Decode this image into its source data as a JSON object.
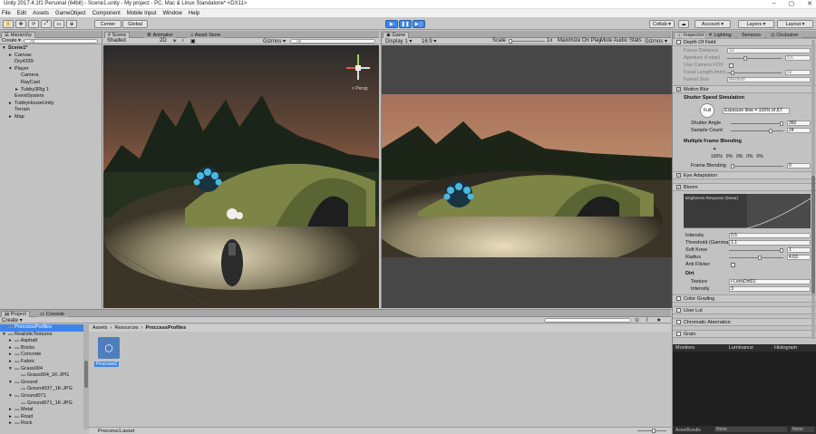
{
  "window": {
    "title": "Unity 2017.4.1f1 Personal (64bit) - Scene1.unity - My project - PC, Mac & Linux Standalone* <DX11>",
    "controls": [
      "–",
      "▢",
      "✕"
    ]
  },
  "menu": [
    "File",
    "Edit",
    "Assets",
    "GameObject",
    "Component",
    "Mobile Input",
    "Window",
    "Help"
  ],
  "toolbar": {
    "center": "Center",
    "global": "Global",
    "collab": "Collab ▾",
    "account": "Account",
    "layers": "Layers",
    "layout": "Layout"
  },
  "hierarchy": {
    "tab": "Hierarchy",
    "create": "Create ▾",
    "search": "All",
    "items": [
      {
        "label": "Scene1*",
        "depth": 0,
        "arrow": "▾",
        "sel": false
      },
      {
        "label": "Canvas",
        "depth": 1,
        "arrow": "▸"
      },
      {
        "label": "Dry4339",
        "depth": 1,
        "arrow": ""
      },
      {
        "label": "Player",
        "depth": 1,
        "arrow": "▾"
      },
      {
        "label": "Camera",
        "depth": 2,
        "arrow": ""
      },
      {
        "label": "RayCast",
        "depth": 2,
        "arrow": ""
      },
      {
        "label": "Tubby3Rig 1",
        "depth": 2,
        "arrow": "▸"
      },
      {
        "label": "EventSystem",
        "depth": 1,
        "arrow": ""
      },
      {
        "label": "TubbyHouseUnity",
        "depth": 1,
        "arrow": "▸"
      },
      {
        "label": "Terrain",
        "depth": 1,
        "arrow": ""
      },
      {
        "label": "Map",
        "depth": 1,
        "arrow": "▸"
      }
    ]
  },
  "scene": {
    "tabs": [
      "Scene",
      "Animator",
      "Asset Store"
    ],
    "shaded": "Shaded",
    "mode2d": "2D",
    "gizmos": "Gizmos ▾",
    "search": "All",
    "persp": "< Persp"
  },
  "game": {
    "tab": "Game",
    "display": "Display 1",
    "aspect": "16:9",
    "scale_label": "Scale",
    "scale_value": "1x",
    "buttons": [
      "Maximize On Play",
      "Mute Audio",
      "Stats",
      "Gizmos ▾"
    ]
  },
  "inspector": {
    "tabs": [
      "Inspector",
      "Lighting",
      "Services",
      "Occlusion"
    ],
    "dof": {
      "title": "Depth Of Field",
      "rows": [
        {
          "label": "Focus Distance",
          "value": "10"
        },
        {
          "label": "Aperture (f-stop)",
          "value": "5.6"
        },
        {
          "label": "Use Camera FOV",
          "value": ""
        },
        {
          "label": "Focal Length (mm)",
          "value": "50"
        },
        {
          "label": "Kernel Size",
          "value": "Medium"
        }
      ]
    },
    "motion_blur": {
      "title": "Motion Blur",
      "shutter_heading": "Shutter Speed Simulation",
      "full": "Full",
      "exposure": "Exposure time = 100% of ΔT",
      "shutter_angle_label": "Shutter Angle",
      "shutter_angle": "360",
      "shutter_angle_fraction": 1.0,
      "sample_count_label": "Sample Count",
      "sample_count": "24",
      "sample_count_fraction": 0.78,
      "blend_heading": "Multiple Frame Blending",
      "blend_percents": [
        "100%",
        "0%",
        "0%",
        "0%",
        "0%"
      ],
      "frame_blending_label": "Frame Blending",
      "frame_blending": "0",
      "frame_blending_fraction": 0.0
    },
    "eye": {
      "title": "Eye Adaptation"
    },
    "bloom": {
      "title": "Bloom",
      "curve_label": "Brightness Response (linear)",
      "intensity_label": "Intensity",
      "intensity": "0.5",
      "threshold_label": "Threshold (Gamma)",
      "threshold": "1.1",
      "soft_knee_label": "Soft Knee",
      "soft_knee": "1",
      "soft_knee_fraction": 1.0,
      "radius_label": "Radius",
      "radius": "4.63",
      "radius_fraction": 0.58,
      "anti_flicker_label": "Anti Flicker",
      "dirt_heading": "Dirt",
      "texture_label": "Texture",
      "texture_value": "LensDirt01",
      "dirt_intensity_label": "Intensity",
      "dirt_intensity": "3"
    },
    "collapsed": [
      "Color Grading",
      "User Lut",
      "Chromatic Aberration",
      "Grain"
    ]
  },
  "monitors": {
    "tabs": [
      "Monitors",
      "Luminance",
      "Histogram"
    ],
    "footer_label": "AssetBundle",
    "footer_a": "None",
    "footer_b": "None"
  },
  "project": {
    "tabs": [
      "Project",
      "Console"
    ],
    "create": "Create ▾",
    "tree": [
      {
        "label": "ProccessProfiles",
        "depth": 0,
        "sel": true
      },
      {
        "label": "RealisticTextures",
        "depth": 0,
        "arrow": "▾"
      },
      {
        "label": "Asphalt",
        "depth": 1,
        "arrow": "▸"
      },
      {
        "label": "Bricks",
        "depth": 1,
        "arrow": "▸"
      },
      {
        "label": "Concrete",
        "depth": 1,
        "arrow": "▸"
      },
      {
        "label": "Fabric",
        "depth": 1,
        "arrow": "▸"
      },
      {
        "label": "Grass004",
        "depth": 1,
        "arrow": "▾"
      },
      {
        "label": "Grass004_1K-JPG",
        "depth": 2,
        "arrow": ""
      },
      {
        "label": "Ground",
        "depth": 1,
        "arrow": "▾"
      },
      {
        "label": "Ground037_1K-JPG",
        "depth": 2,
        "arrow": ""
      },
      {
        "label": "Ground071",
        "depth": 1,
        "arrow": "▾"
      },
      {
        "label": "Ground071_1K-JPG",
        "depth": 2,
        "arrow": ""
      },
      {
        "label": "Metal",
        "depth": 1,
        "arrow": "▸"
      },
      {
        "label": "Road",
        "depth": 1,
        "arrow": "▸"
      },
      {
        "label": "Rock",
        "depth": 1,
        "arrow": "▸"
      }
    ],
    "breadcrumb": [
      "Assets",
      "Resources",
      "ProccessProfiles"
    ],
    "asset_name": "Proccess1",
    "footer_file": "Proccess1.asset"
  },
  "colors": {
    "selection": "#3d86e6",
    "panel": "#c2c2c2",
    "dark": "#1e1e1e"
  }
}
